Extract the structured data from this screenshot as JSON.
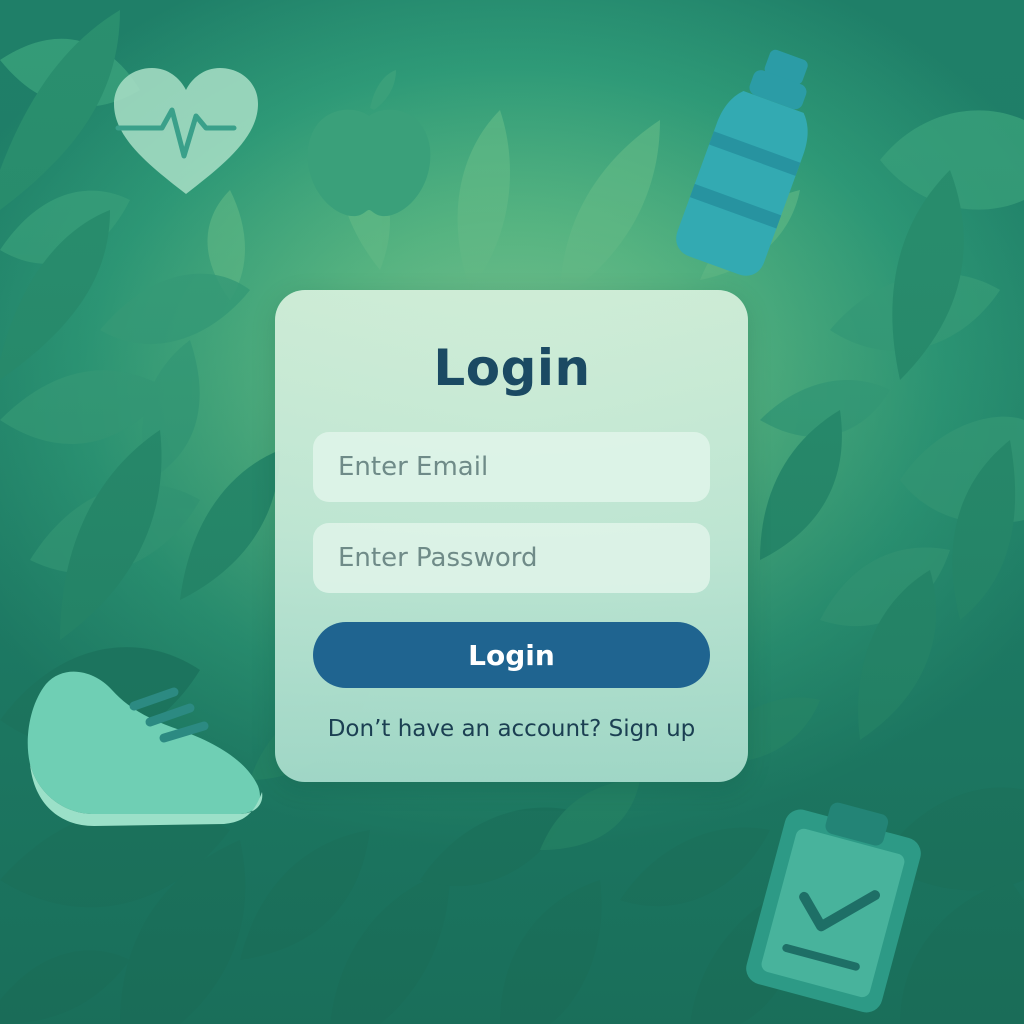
{
  "login_card": {
    "title": "Login",
    "email_placeholder": "Enter Email",
    "password_placeholder": "Enter Password",
    "submit_label": "Login",
    "signup_prompt": "Don’t have an account?",
    "signup_link": "Sign up"
  },
  "theme": {
    "accent": "#1f6490",
    "title_color": "#1b4a63",
    "background_green": "#2f9b78"
  },
  "decor_icons": [
    "heart-rate-icon",
    "apple-icon",
    "water-bottle-icon",
    "sneaker-icon",
    "clipboard-check-icon"
  ]
}
